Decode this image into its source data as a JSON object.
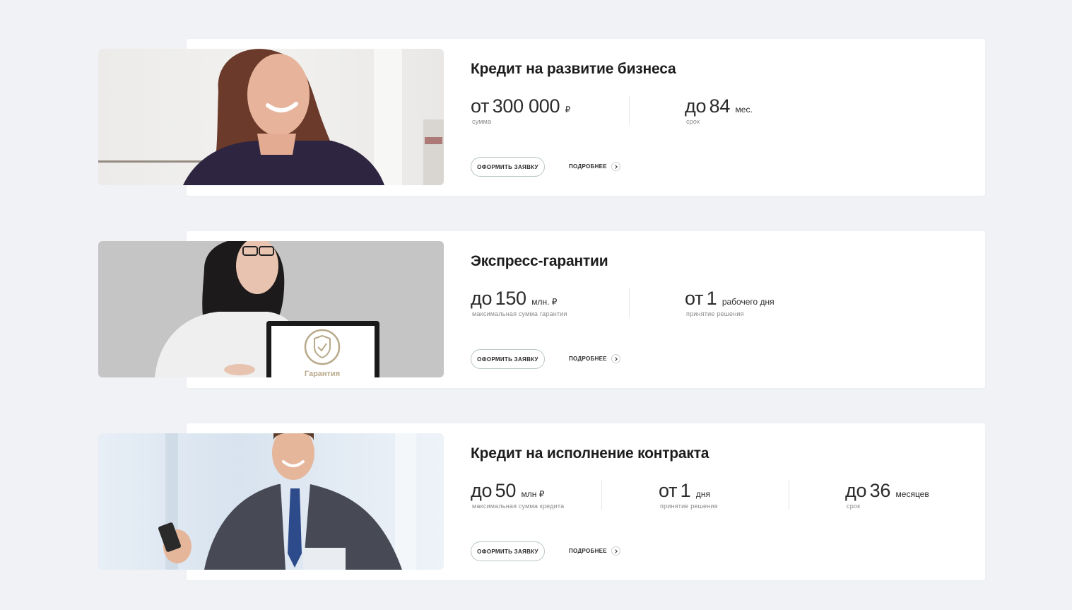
{
  "common": {
    "apply_label": "ОФОРМИТЬ ЗАЯВКУ",
    "more_label": "ПОДРОБНЕЕ"
  },
  "products": [
    {
      "title": "Кредит на развитие бизнеса",
      "image_alt": "woman-smiling-photo",
      "stats": [
        {
          "prefix": "от",
          "value": "300 000",
          "unit": "₽",
          "caption": "сумма"
        },
        {
          "prefix": "до",
          "value": "84",
          "unit": "мес.",
          "caption": "срок"
        }
      ]
    },
    {
      "title": "Экспресс-гарантии",
      "image_alt": "woman-with-tablet-guarantee-photo",
      "image_text": "Гарантия",
      "stats": [
        {
          "prefix": "до",
          "value": "150",
          "unit": "млн. ₽",
          "caption": "максимальная сумма гарантии"
        },
        {
          "prefix": "от",
          "value": "1",
          "unit": "рабочего дня",
          "caption": "принятие решения"
        }
      ]
    },
    {
      "title": "Кредит на исполнение контракта",
      "image_alt": "businessman-with-phone-photo",
      "stats": [
        {
          "prefix": "до",
          "value": "50",
          "unit": "млн ₽",
          "caption": "максимальная сумма кредита"
        },
        {
          "prefix": "от",
          "value": "1",
          "unit": "дня",
          "caption": "принятие решения"
        },
        {
          "prefix": "до",
          "value": "36",
          "unit": "месяцев",
          "caption": "срок"
        }
      ]
    }
  ]
}
